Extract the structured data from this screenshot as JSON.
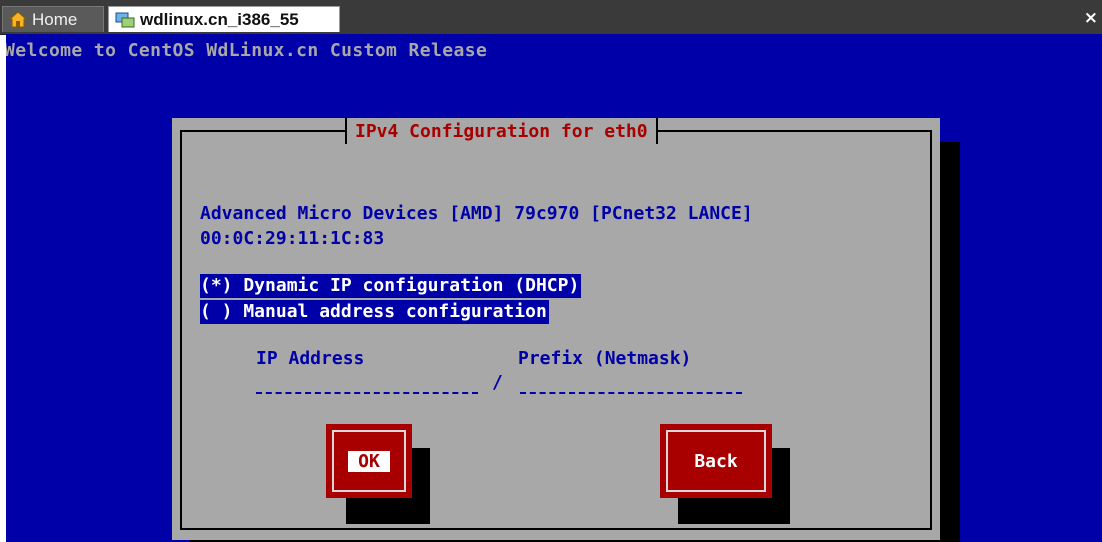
{
  "tabs": [
    {
      "label": "Home",
      "icon": "home-icon"
    },
    {
      "label": "wdlinux.cn_i386_55",
      "icon": "vm-icon"
    }
  ],
  "close_label": "×",
  "console": {
    "welcome": "Welcome to CentOS WdLinux.cn Custom Release"
  },
  "dialog": {
    "title": "IPv4 Configuration for eth0",
    "device_line": "Advanced Micro Devices [AMD] 79c970 [PCnet32 LANCE]",
    "mac_line": "00:0C:29:11:1C:83",
    "options": [
      {
        "label": "(*) Dynamic IP configuration (DHCP)",
        "selected": true
      },
      {
        "label": "( ) Manual address configuration",
        "selected": false
      }
    ],
    "ip_label": "IP Address",
    "prefix_label": "Prefix (Netmask)",
    "ip_value": "",
    "prefix_value": "",
    "separator": "/",
    "ok_label": "OK",
    "back_label": "Back"
  },
  "colors": {
    "console_bg": "#0000a8",
    "dialog_bg": "#a8a8a8",
    "accent_red": "#a80000",
    "text_blue": "#0000a8"
  }
}
